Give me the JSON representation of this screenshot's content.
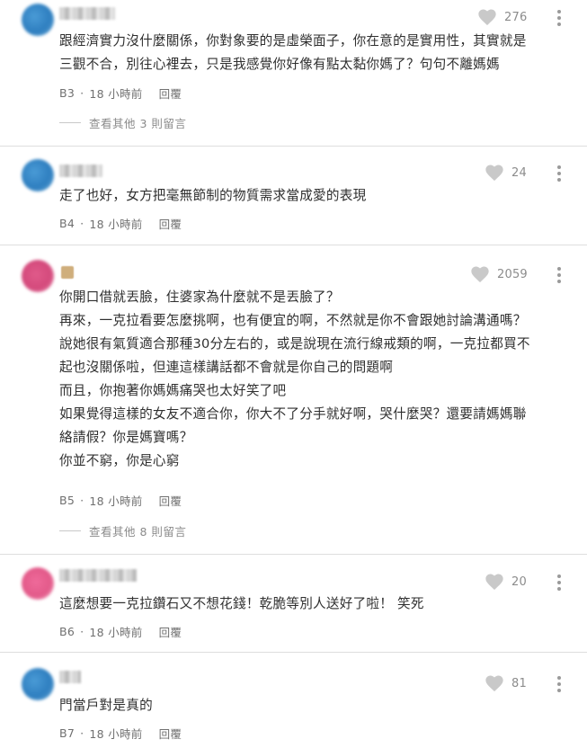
{
  "comments": [
    {
      "avatar_color": "#2f7fc0",
      "likes": "276",
      "lines": [
        "跟經濟實力沒什麼關係，你對象要的是虛榮面子，你在意的是實用性，其實就是",
        "三觀不合，別往心裡去，只是我感覺你好像有點太黏你媽了？句句不離媽媽"
      ],
      "floor": "B3",
      "time": "18 小時前",
      "reply": "回覆",
      "more_replies": "查看其他 3 則留言"
    },
    {
      "avatar_color": "#2f7fc0",
      "likes": "24",
      "lines": [
        "走了也好，女方把毫無節制的物質需求當成愛的表現"
      ],
      "floor": "B4",
      "time": "18 小時前",
      "reply": "回覆"
    },
    {
      "avatar_color": "#d44a7c",
      "likes": "2059",
      "lines": [
        "你開口借就丟臉，住婆家為什麼就不是丟臉了？",
        "再來，一克拉看要怎麼挑啊，也有便宜的啊，不然就是你不會跟她討論溝通嗎？",
        "說她很有氣質適合那種30分左右的，或是說現在流行線戒類的啊，一克拉都買不",
        "起也沒關係啦，但連這樣講話都不會就是你自己的問題啊",
        "而且，你抱著你媽媽痛哭也太好笑了吧",
        "如果覺得這樣的女友不適合你，你大不了分手就好啊，哭什麼哭？還要請媽媽聯",
        "絡請假？你是媽寶嗎？",
        "你並不窮，你是心窮"
      ],
      "floor": "B5",
      "time": "18 小時前",
      "reply": "回覆",
      "more_replies": "查看其他 8 則留言"
    },
    {
      "avatar_color": "#e35a8a",
      "likes": "20",
      "lines": [
        "這麼想要一克拉鑽石又不想花錢！乾脆等別人送好了啦！ 笑死"
      ],
      "floor": "B6",
      "time": "18 小時前",
      "reply": "回覆"
    },
    {
      "avatar_color": "#2f7fc0",
      "likes": "81",
      "lines": [
        "門當戶對是真的"
      ],
      "floor": "B7",
      "time": "18 小時前",
      "reply": "回覆"
    }
  ],
  "icons": {
    "like": "heart-icon",
    "more": "more-vertical-icon"
  }
}
